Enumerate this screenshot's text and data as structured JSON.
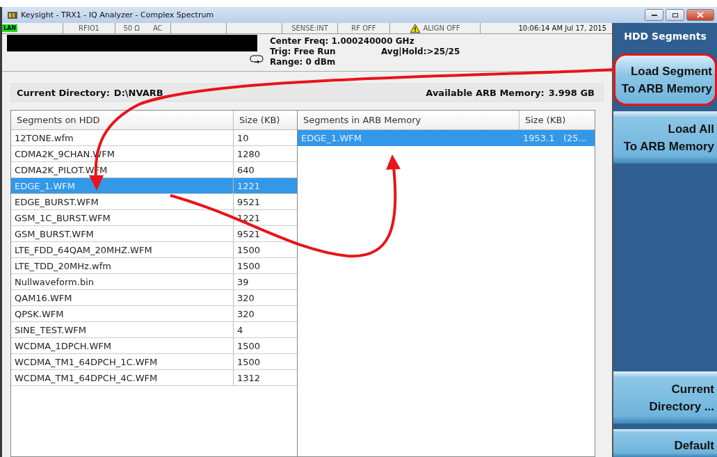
{
  "window": {
    "title": "Keysight - TRX1 - IQ Analyzer - Complex Spectrum"
  },
  "status_bar": [
    {
      "kind": "lan",
      "text": "LAN"
    },
    {
      "kind": "text",
      "text": "RFIO1"
    },
    {
      "kind": "pair",
      "text": "50 Ω",
      "text2": "AC"
    },
    {
      "kind": "empty"
    },
    {
      "kind": "empty"
    },
    {
      "kind": "text",
      "text": "SENSE:INT"
    },
    {
      "kind": "text",
      "text": "RF OFF"
    },
    {
      "kind": "warning",
      "text": "ALIGN OFF"
    },
    {
      "kind": "time",
      "text": "10:06:14 AM Jul 17, 2015"
    }
  ],
  "info": {
    "center_freq": "Center Freq: 1.000240000 GHz",
    "trig": "Trig: Free Run",
    "avg_hold": "Avg|Hold:>25/25",
    "range": "Range: 0 dBm"
  },
  "directory": {
    "label": "Current Directory:",
    "value": "D:\\NVARB",
    "memory_label": "Available ARB Memory:",
    "memory_value": "3.998 GB"
  },
  "hdd_table": {
    "columns": [
      "Segments on HDD",
      "Size (KB)"
    ],
    "rows": [
      {
        "name": "12TONE.wfm",
        "size": "10",
        "selected": false
      },
      {
        "name": "CDMA2K_9CHAN.WFM",
        "size": "1280",
        "selected": false
      },
      {
        "name": "CDMA2K_PILOT.WFM",
        "size": "640",
        "selected": false
      },
      {
        "name": "EDGE_1.WFM",
        "size": "1221",
        "selected": true
      },
      {
        "name": "EDGE_BURST.WFM",
        "size": "9521",
        "selected": false
      },
      {
        "name": "GSM_1C_BURST.WFM",
        "size": "1221",
        "selected": false
      },
      {
        "name": "GSM_BURST.WFM",
        "size": "9521",
        "selected": false
      },
      {
        "name": "LTE_FDD_64QAM_20MHZ.WFM",
        "size": "1500",
        "selected": false
      },
      {
        "name": "LTE_TDD_20MHz.wfm",
        "size": "1500",
        "selected": false
      },
      {
        "name": "Nullwaveform.bin",
        "size": "39",
        "selected": false
      },
      {
        "name": "QAM16.WFM",
        "size": "320",
        "selected": false
      },
      {
        "name": "QPSK.WFM",
        "size": "320",
        "selected": false
      },
      {
        "name": "SINE_TEST.WFM",
        "size": "4",
        "selected": false
      },
      {
        "name": "WCDMA_1DPCH.WFM",
        "size": "1500",
        "selected": false
      },
      {
        "name": "WCDMA_TM1_64DPCH_1C.WFM",
        "size": "1500",
        "selected": false
      },
      {
        "name": "WCDMA_TM1_64DPCH_4C.WFM",
        "size": "1312",
        "selected": false
      }
    ]
  },
  "arb_table": {
    "columns": [
      "Segments in ARB Memory",
      "Size (KB)"
    ],
    "rows": [
      {
        "name": "EDGE_1.WFM",
        "size": "1953.1   (25...",
        "selected": true
      }
    ]
  },
  "softkeys": {
    "title": "HDD Segments",
    "keys": [
      {
        "kind": "key",
        "label": "Load Segment\nTo ARB Memory",
        "annotated": true
      },
      {
        "kind": "key",
        "label": "Load All\nTo ARB Memory"
      },
      {
        "kind": "blank"
      },
      {
        "kind": "key",
        "label": "Current\nDirectory ..."
      },
      {
        "kind": "key",
        "label": "Default"
      }
    ]
  }
}
